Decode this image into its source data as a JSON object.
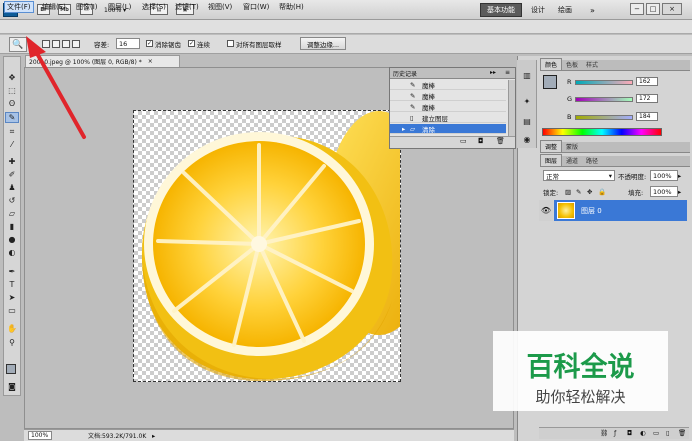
{
  "app": {
    "logo": "Ps",
    "top_icons": [
      "Br",
      "Mb"
    ],
    "zoom": "100%",
    "workspaces": {
      "active": "基本功能",
      "items": [
        "设计",
        "绘画"
      ]
    },
    "window_buttons": [
      "−",
      "□",
      "×"
    ]
  },
  "menubar": {
    "items": [
      "文件(F)",
      "编辑(E)",
      "图像(I)",
      "图层(L)",
      "选择(S)",
      "滤镜(T)",
      "视图(V)",
      "窗口(W)",
      "帮助(H)"
    ]
  },
  "options": {
    "tool_icon": "magic-wand-icon",
    "tolerance_label": "容差:",
    "tolerance_value": "16",
    "antialias_label": "消除锯齿",
    "contiguous_label": "连续",
    "sample_all_label": "对所有图层取样",
    "refine_edge_label": "调整边缘..."
  },
  "document": {
    "tab_title": "20010.jpeg @ 100% (图层 0, RGB/8) *",
    "status_zoom": "100%",
    "status_doc": "文档:593.2K/791.0K"
  },
  "history": {
    "title": "历史记录",
    "items": [
      {
        "label": "魔棒"
      },
      {
        "label": "魔棒"
      },
      {
        "label": "魔棒"
      },
      {
        "label": "建立图层"
      },
      {
        "label": "清除"
      }
    ]
  },
  "color_panel": {
    "tabs": [
      "颜色",
      "色板",
      "样式"
    ],
    "r_label": "R",
    "r_value": "162",
    "g_label": "G",
    "g_value": "172",
    "b_label": "B",
    "b_value": "184"
  },
  "adjust_panel": {
    "tabs": [
      "调整",
      "蒙版"
    ]
  },
  "layers_panel": {
    "tabs": [
      "图层",
      "通道",
      "路径"
    ],
    "blend_mode": "正常",
    "opacity_label": "不透明度:",
    "opacity_value": "100%",
    "lock_label": "锁定:",
    "fill_label": "填充:",
    "fill_value": "100%",
    "layer_name": "图层 0"
  },
  "watermark": {
    "title": "百科全说",
    "subtitle": "助你轻松解决"
  },
  "colors": {
    "accent": "#3a78d6",
    "arrow": "#e0252b",
    "watermark_green": "#1c9a4a"
  }
}
